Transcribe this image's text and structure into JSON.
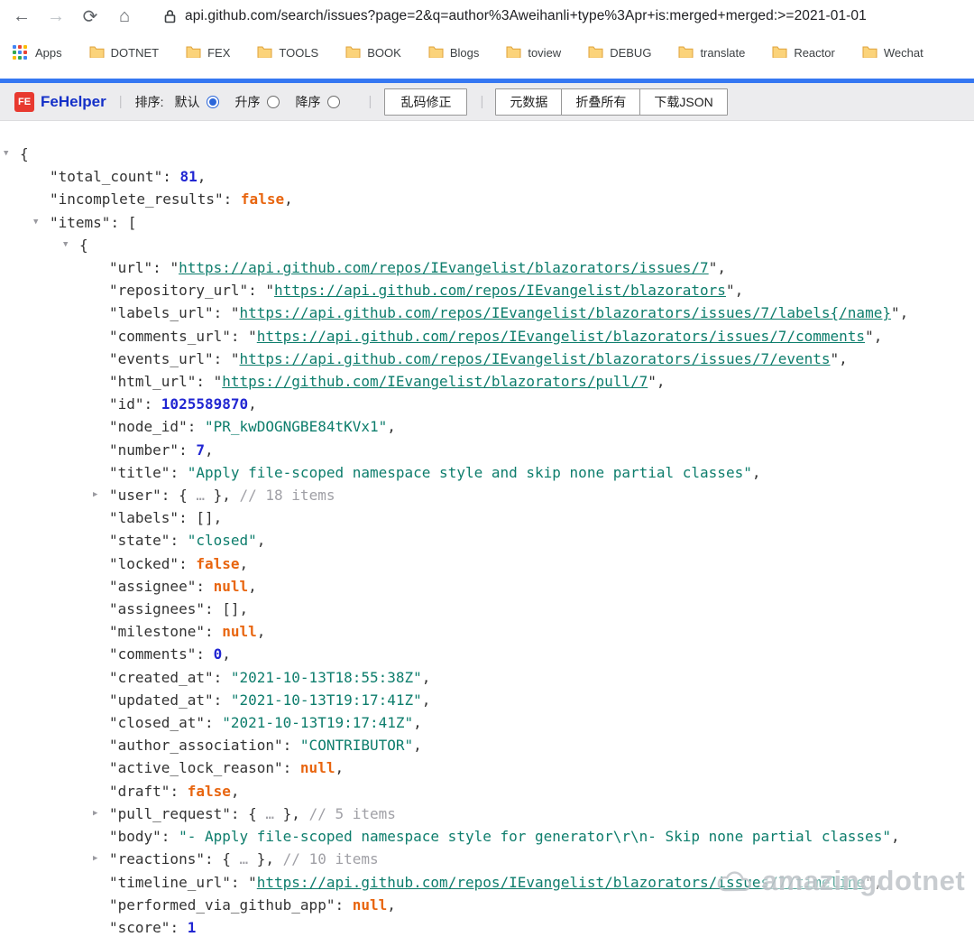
{
  "browser": {
    "url": "api.github.com/search/issues?page=2&q=author%3Aweihanli+type%3Apr+is:merged+merged:>=2021-01-01",
    "apps_label": "Apps",
    "bookmarks": [
      "DOTNET",
      "FEX",
      "TOOLS",
      "BOOK",
      "Blogs",
      "toview",
      "DEBUG",
      "translate",
      "Reactor",
      "Wechat"
    ]
  },
  "fehelper": {
    "logo_text": "FE",
    "brand": "FeHelper",
    "sort_label": "排序:",
    "sort_options": [
      {
        "label": "默认",
        "selected": true
      },
      {
        "label": "升序",
        "selected": false
      },
      {
        "label": "降序",
        "selected": false
      }
    ],
    "fix_button": "乱码修正",
    "group_buttons": [
      {
        "label": "元数据",
        "name": "metadata-button"
      },
      {
        "label": "折叠所有",
        "name": "collapse-all-button"
      },
      {
        "label": "下载JSON",
        "name": "download-json-button"
      }
    ]
  },
  "watermark": {
    "text": "amazingdotnet"
  },
  "json_viewer": {
    "colors": {
      "key": "#333333",
      "number": "#2126d2",
      "literal": "#e8650f",
      "string": "#0d7d6c",
      "comment": "#a0a0a6",
      "accent_blue": "#3577f2",
      "brand_red": "#e8392f"
    },
    "lines": [
      {
        "indent": 0,
        "tri": "down",
        "tokens": [
          [
            "p",
            "{"
          ]
        ]
      },
      {
        "indent": 1,
        "tri": null,
        "tokens": [
          [
            "k",
            "\"total_count\""
          ],
          [
            "p",
            ": "
          ],
          [
            "n",
            "81"
          ],
          [
            "p",
            ","
          ]
        ]
      },
      {
        "indent": 1,
        "tri": null,
        "tokens": [
          [
            "k",
            "\"incomplete_results\""
          ],
          [
            "p",
            ": "
          ],
          [
            "b",
            "false"
          ],
          [
            "p",
            ","
          ]
        ]
      },
      {
        "indent": 1,
        "tri": "down",
        "tokens": [
          [
            "k",
            "\"items\""
          ],
          [
            "p",
            ": ["
          ]
        ]
      },
      {
        "indent": 2,
        "tri": "down",
        "tokens": [
          [
            "p",
            "{"
          ]
        ]
      },
      {
        "indent": 3,
        "tri": null,
        "tokens": [
          [
            "k",
            "\"url\""
          ],
          [
            "p",
            ": \""
          ],
          [
            "l",
            "https://api.github.com/repos/IEvangelist/blazorators/issues/7"
          ],
          [
            "p",
            "\","
          ]
        ]
      },
      {
        "indent": 3,
        "tri": null,
        "tokens": [
          [
            "k",
            "\"repository_url\""
          ],
          [
            "p",
            ": \""
          ],
          [
            "l",
            "https://api.github.com/repos/IEvangelist/blazorators"
          ],
          [
            "p",
            "\","
          ]
        ]
      },
      {
        "indent": 3,
        "tri": null,
        "tokens": [
          [
            "k",
            "\"labels_url\""
          ],
          [
            "p",
            ": \""
          ],
          [
            "l",
            "https://api.github.com/repos/IEvangelist/blazorators/issues/7/labels{/name}"
          ],
          [
            "p",
            "\","
          ]
        ]
      },
      {
        "indent": 3,
        "tri": null,
        "tokens": [
          [
            "k",
            "\"comments_url\""
          ],
          [
            "p",
            ": \""
          ],
          [
            "l",
            "https://api.github.com/repos/IEvangelist/blazorators/issues/7/comments"
          ],
          [
            "p",
            "\","
          ]
        ]
      },
      {
        "indent": 3,
        "tri": null,
        "tokens": [
          [
            "k",
            "\"events_url\""
          ],
          [
            "p",
            ": \""
          ],
          [
            "l",
            "https://api.github.com/repos/IEvangelist/blazorators/issues/7/events"
          ],
          [
            "p",
            "\","
          ]
        ]
      },
      {
        "indent": 3,
        "tri": null,
        "tokens": [
          [
            "k",
            "\"html_url\""
          ],
          [
            "p",
            ": \""
          ],
          [
            "l",
            "https://github.com/IEvangelist/blazorators/pull/7"
          ],
          [
            "p",
            "\","
          ]
        ]
      },
      {
        "indent": 3,
        "tri": null,
        "tokens": [
          [
            "k",
            "\"id\""
          ],
          [
            "p",
            ": "
          ],
          [
            "n",
            "1025589870"
          ],
          [
            "p",
            ","
          ]
        ]
      },
      {
        "indent": 3,
        "tri": null,
        "tokens": [
          [
            "k",
            "\"node_id\""
          ],
          [
            "p",
            ": "
          ],
          [
            "s",
            "\"PR_kwDOGNGBE84tKVx1\""
          ],
          [
            "p",
            ","
          ]
        ]
      },
      {
        "indent": 3,
        "tri": null,
        "tokens": [
          [
            "k",
            "\"number\""
          ],
          [
            "p",
            ": "
          ],
          [
            "n",
            "7"
          ],
          [
            "p",
            ","
          ]
        ]
      },
      {
        "indent": 3,
        "tri": null,
        "tokens": [
          [
            "k",
            "\"title\""
          ],
          [
            "p",
            ": "
          ],
          [
            "s",
            "\"Apply file-scoped namespace style and skip none partial classes\""
          ],
          [
            "p",
            ","
          ]
        ]
      },
      {
        "indent": 3,
        "tri": "right",
        "tokens": [
          [
            "k",
            "\"user\""
          ],
          [
            "p",
            ": { "
          ],
          [
            "c",
            "…"
          ],
          [
            "p",
            " }, "
          ],
          [
            "c",
            "// 18 items"
          ]
        ]
      },
      {
        "indent": 3,
        "tri": null,
        "tokens": [
          [
            "k",
            "\"labels\""
          ],
          [
            "p",
            ": [],"
          ]
        ]
      },
      {
        "indent": 3,
        "tri": null,
        "tokens": [
          [
            "k",
            "\"state\""
          ],
          [
            "p",
            ": "
          ],
          [
            "s",
            "\"closed\""
          ],
          [
            "p",
            ","
          ]
        ]
      },
      {
        "indent": 3,
        "tri": null,
        "tokens": [
          [
            "k",
            "\"locked\""
          ],
          [
            "p",
            ": "
          ],
          [
            "b",
            "false"
          ],
          [
            "p",
            ","
          ]
        ]
      },
      {
        "indent": 3,
        "tri": null,
        "tokens": [
          [
            "k",
            "\"assignee\""
          ],
          [
            "p",
            ": "
          ],
          [
            "b",
            "null"
          ],
          [
            "p",
            ","
          ]
        ]
      },
      {
        "indent": 3,
        "tri": null,
        "tokens": [
          [
            "k",
            "\"assignees\""
          ],
          [
            "p",
            ": [],"
          ]
        ]
      },
      {
        "indent": 3,
        "tri": null,
        "tokens": [
          [
            "k",
            "\"milestone\""
          ],
          [
            "p",
            ": "
          ],
          [
            "b",
            "null"
          ],
          [
            "p",
            ","
          ]
        ]
      },
      {
        "indent": 3,
        "tri": null,
        "tokens": [
          [
            "k",
            "\"comments\""
          ],
          [
            "p",
            ": "
          ],
          [
            "n",
            "0"
          ],
          [
            "p",
            ","
          ]
        ]
      },
      {
        "indent": 3,
        "tri": null,
        "tokens": [
          [
            "k",
            "\"created_at\""
          ],
          [
            "p",
            ": "
          ],
          [
            "s",
            "\"2021-10-13T18:55:38Z\""
          ],
          [
            "p",
            ","
          ]
        ]
      },
      {
        "indent": 3,
        "tri": null,
        "tokens": [
          [
            "k",
            "\"updated_at\""
          ],
          [
            "p",
            ": "
          ],
          [
            "s",
            "\"2021-10-13T19:17:41Z\""
          ],
          [
            "p",
            ","
          ]
        ]
      },
      {
        "indent": 3,
        "tri": null,
        "tokens": [
          [
            "k",
            "\"closed_at\""
          ],
          [
            "p",
            ": "
          ],
          [
            "s",
            "\"2021-10-13T19:17:41Z\""
          ],
          [
            "p",
            ","
          ]
        ]
      },
      {
        "indent": 3,
        "tri": null,
        "tokens": [
          [
            "k",
            "\"author_association\""
          ],
          [
            "p",
            ": "
          ],
          [
            "s",
            "\"CONTRIBUTOR\""
          ],
          [
            "p",
            ","
          ]
        ]
      },
      {
        "indent": 3,
        "tri": null,
        "tokens": [
          [
            "k",
            "\"active_lock_reason\""
          ],
          [
            "p",
            ": "
          ],
          [
            "b",
            "null"
          ],
          [
            "p",
            ","
          ]
        ]
      },
      {
        "indent": 3,
        "tri": null,
        "tokens": [
          [
            "k",
            "\"draft\""
          ],
          [
            "p",
            ": "
          ],
          [
            "b",
            "false"
          ],
          [
            "p",
            ","
          ]
        ]
      },
      {
        "indent": 3,
        "tri": "right",
        "tokens": [
          [
            "k",
            "\"pull_request\""
          ],
          [
            "p",
            ": { "
          ],
          [
            "c",
            "…"
          ],
          [
            "p",
            " }, "
          ],
          [
            "c",
            "// 5 items"
          ]
        ]
      },
      {
        "indent": 3,
        "tri": null,
        "tokens": [
          [
            "k",
            "\"body\""
          ],
          [
            "p",
            ": "
          ],
          [
            "s",
            "\"- Apply file-scoped namespace style for generator\\r\\n- Skip none partial classes\""
          ],
          [
            "p",
            ","
          ]
        ]
      },
      {
        "indent": 3,
        "tri": "right",
        "tokens": [
          [
            "k",
            "\"reactions\""
          ],
          [
            "p",
            ": { "
          ],
          [
            "c",
            "…"
          ],
          [
            "p",
            " }, "
          ],
          [
            "c",
            "// 10 items"
          ]
        ]
      },
      {
        "indent": 3,
        "tri": null,
        "tokens": [
          [
            "k",
            "\"timeline_url\""
          ],
          [
            "p",
            ": \""
          ],
          [
            "l",
            "https://api.github.com/repos/IEvangelist/blazorators/issues/7/timeline"
          ],
          [
            "p",
            "\","
          ]
        ]
      },
      {
        "indent": 3,
        "tri": null,
        "tokens": [
          [
            "k",
            "\"performed_via_github_app\""
          ],
          [
            "p",
            ": "
          ],
          [
            "b",
            "null"
          ],
          [
            "p",
            ","
          ]
        ]
      },
      {
        "indent": 3,
        "tri": null,
        "tokens": [
          [
            "k",
            "\"score\""
          ],
          [
            "p",
            ": "
          ],
          [
            "n",
            "1"
          ]
        ]
      }
    ]
  }
}
